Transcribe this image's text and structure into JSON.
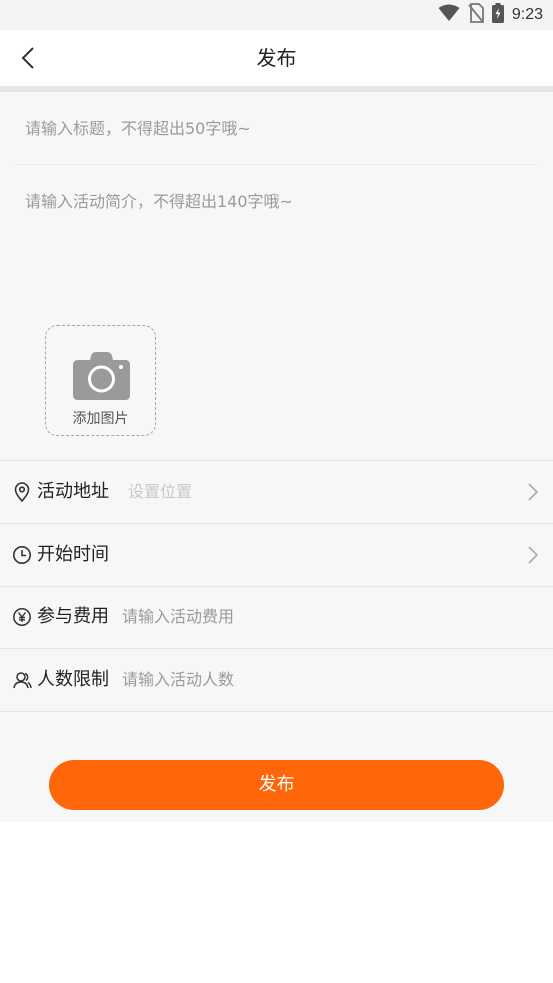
{
  "status_bar": {
    "time": "9:23",
    "icons": [
      "wifi-icon",
      "no-sim-icon",
      "battery-charging-icon"
    ]
  },
  "nav": {
    "title": "发布",
    "back_icon": "chevron-left-icon"
  },
  "form": {
    "title_placeholder": "请输入标题，不得超出50字哦~",
    "desc_placeholder": "请输入活动简介，不得超出140字哦~",
    "add_photo_label": "添加图片",
    "rows": {
      "address": {
        "label": "活动地址",
        "placeholder": "设置位置",
        "icon": "location-pin-icon"
      },
      "start_time": {
        "label": "开始时间",
        "icon": "clock-icon"
      },
      "fee": {
        "label": "参与费用",
        "placeholder": "请输入活动费用",
        "icon": "yen-icon"
      },
      "limit": {
        "label": "人数限制",
        "placeholder": "请输入活动人数",
        "icon": "people-icon"
      }
    }
  },
  "submit": {
    "label": "发布"
  },
  "colors": {
    "accent": "#ff6609",
    "background": "#f7f7f7",
    "text": "#222222",
    "placeholder": "#9a9a9a"
  }
}
